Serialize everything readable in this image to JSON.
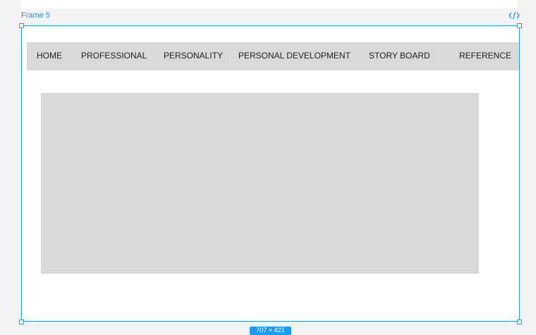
{
  "canvas": {
    "frame_label": "Frame 5",
    "code_icon": "code-icon",
    "size_badge": "707 × 421"
  },
  "navbar": {
    "items": [
      {
        "label": "HOME"
      },
      {
        "label": "PROFESSIONAL"
      },
      {
        "label": "PERSONALITY"
      },
      {
        "label": "PERSONAL DEVELOPMENT"
      },
      {
        "label": "STORY BOARD"
      },
      {
        "label": "REFERENCE"
      }
    ]
  },
  "colors": {
    "selection_accent": "#1e9bf0",
    "placeholder_fill": "#d9d9d9",
    "canvas_background": "#f3f3f3"
  }
}
